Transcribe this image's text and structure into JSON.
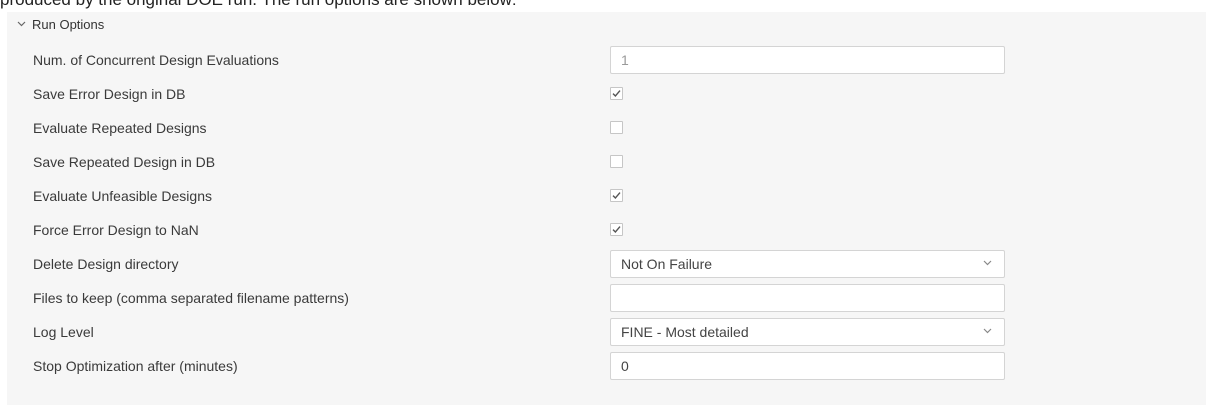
{
  "top_text": "produced by the original DOE run. The run options are shown below:",
  "panel": {
    "title": "Run Options",
    "collapse_icon": "chevron-down-icon"
  },
  "rows": [
    {
      "label": "Num. of Concurrent Design Evaluations",
      "type": "text",
      "value": "1"
    },
    {
      "label": "Save Error Design in DB",
      "type": "checkbox",
      "checked": true
    },
    {
      "label": "Evaluate Repeated Designs",
      "type": "checkbox",
      "checked": false
    },
    {
      "label": "Save Repeated Design in DB",
      "type": "checkbox",
      "checked": false
    },
    {
      "label": "Evaluate Unfeasible Designs",
      "type": "checkbox",
      "checked": true
    },
    {
      "label": "Force Error Design to NaN",
      "type": "checkbox",
      "checked": true
    },
    {
      "label": "Delete Design directory",
      "type": "select",
      "value": "Not On Failure"
    },
    {
      "label": "Files to keep (comma separated filename patterns)",
      "type": "text",
      "value": ""
    },
    {
      "label": "Log Level",
      "type": "select",
      "value": "FINE - Most detailed"
    },
    {
      "label": "Stop Optimization after (minutes)",
      "type": "text",
      "value": "0"
    }
  ]
}
